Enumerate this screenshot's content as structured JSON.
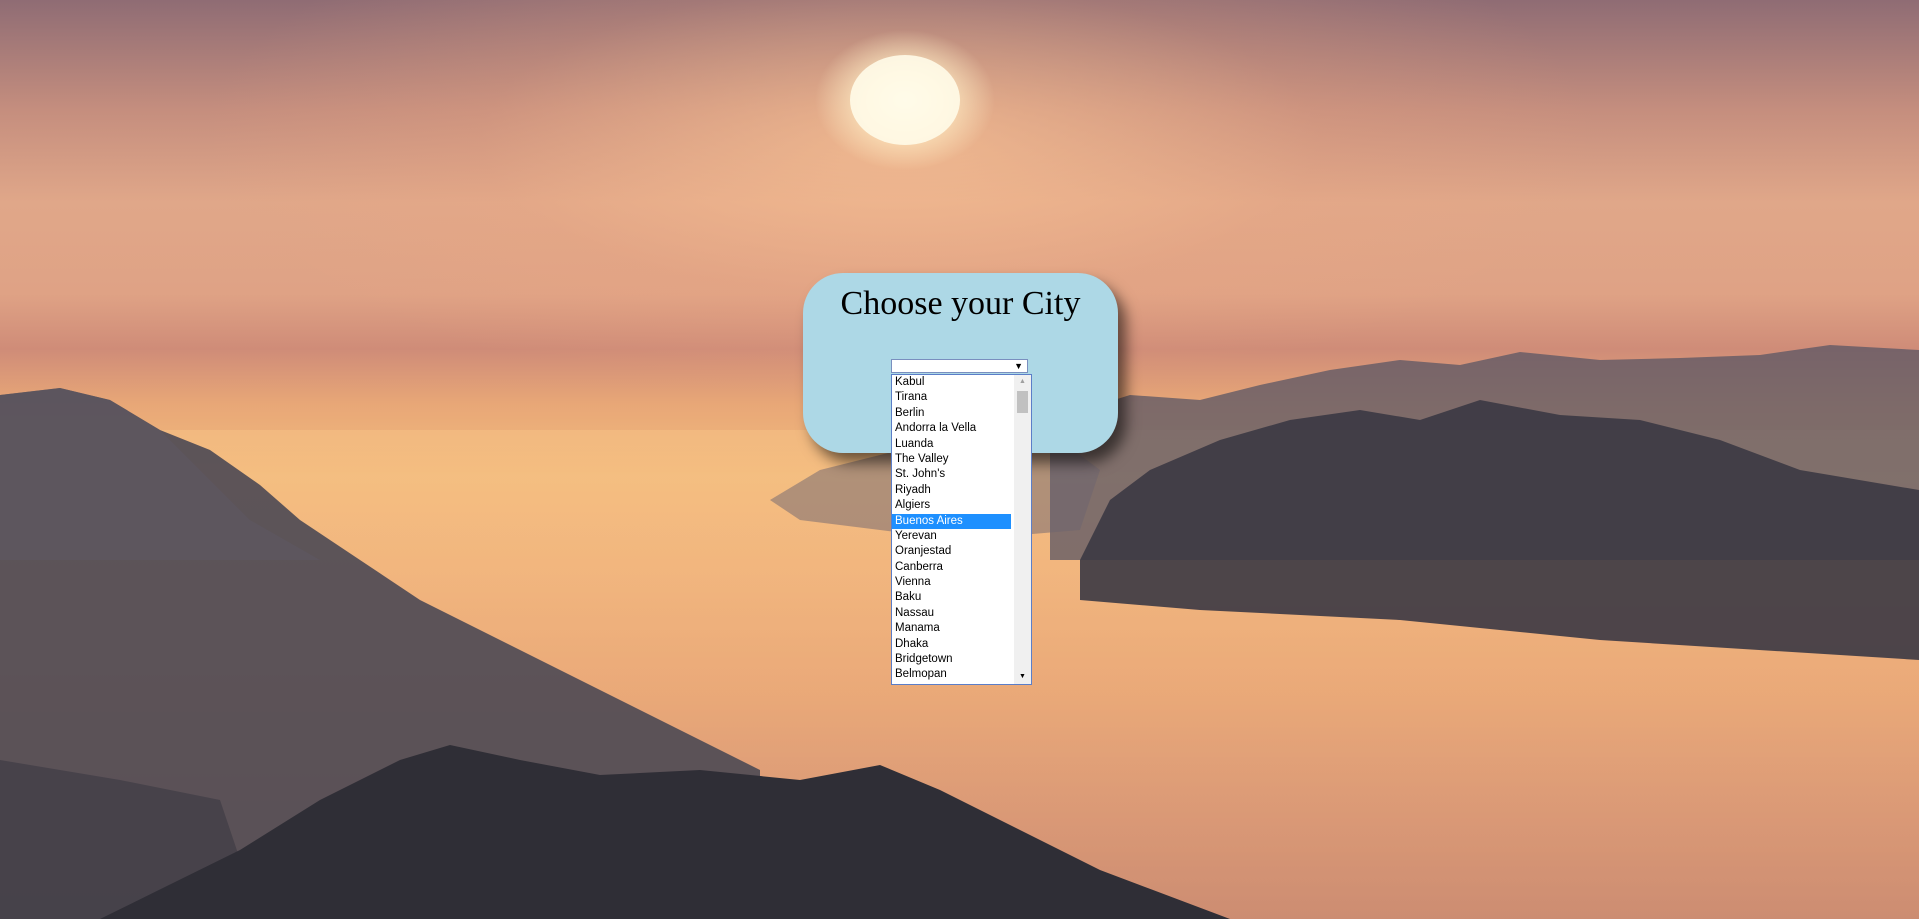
{
  "card": {
    "title": "Choose your City"
  },
  "select": {
    "value": "",
    "arrow": "▼"
  },
  "dropdown": {
    "options": [
      "Kabul",
      "Tirana",
      "Berlin",
      "Andorra la Vella",
      "Luanda",
      "The Valley",
      "St. John's",
      "Riyadh",
      "Algiers",
      "Buenos Aires",
      "Yerevan",
      "Oranjestad",
      "Canberra",
      "Vienna",
      "Baku",
      "Nassau",
      "Manama",
      "Dhaka",
      "Bridgetown",
      "Belmopan"
    ],
    "selected": "Buenos Aires",
    "scroll_up": "▲",
    "scroll_down": "▼"
  },
  "colors": {
    "card_background": "#add8e6",
    "selected_option": "#1e90ff"
  }
}
